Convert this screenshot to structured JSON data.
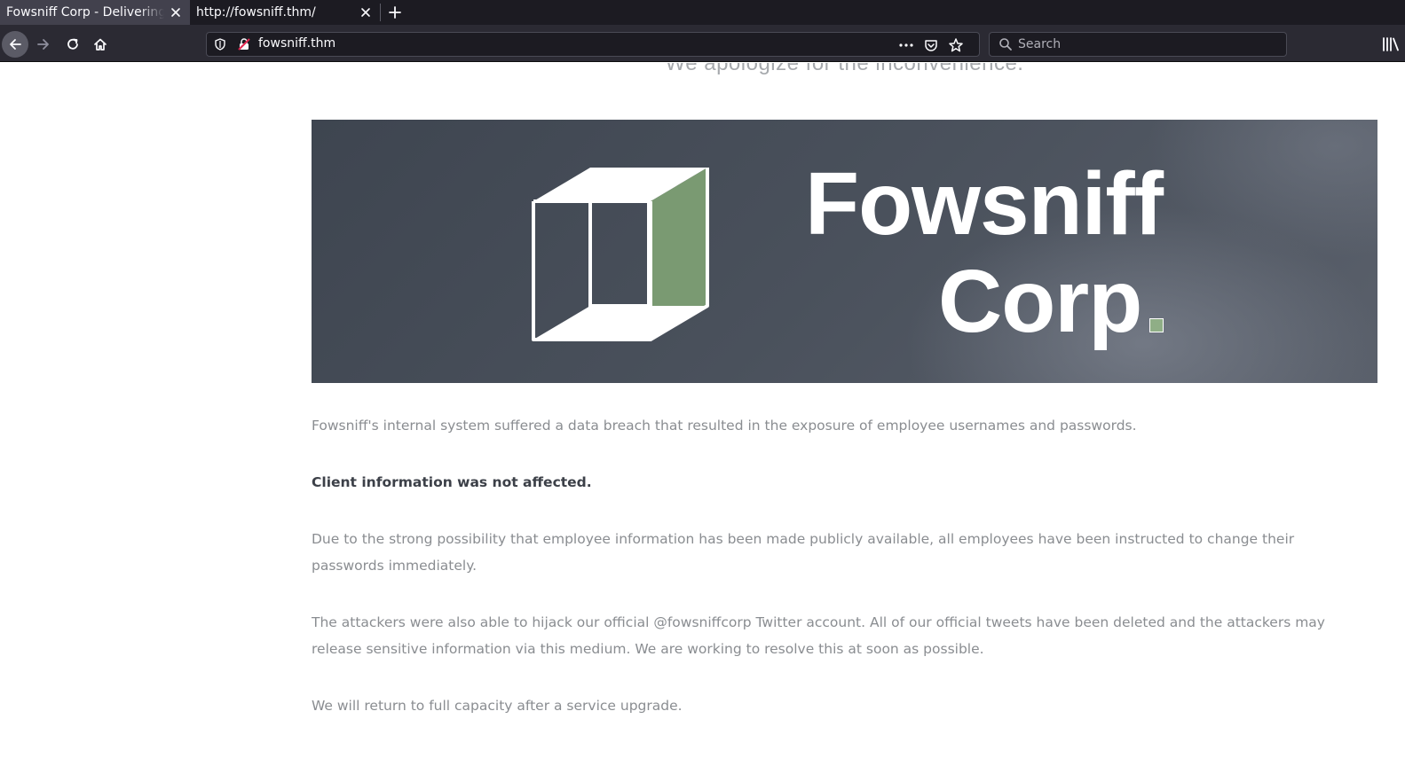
{
  "browser": {
    "tabs": [
      {
        "title": "Fowsniff Corp - Delivering Solutions",
        "active": true
      },
      {
        "title": "http://fowsniff.thm/",
        "active": false
      }
    ],
    "url": "fowsniff.thm",
    "search_placeholder": "Search"
  },
  "page": {
    "partial_heading": "We apologize for the inconvenience.",
    "banner": {
      "brand_line1": "Fowsniff",
      "brand_line2": "Corp",
      "accent_color": "#8fae86"
    },
    "paragraphs": [
      "Fowsniff's internal system suffered a data breach that resulted in the exposure of employee usernames and passwords.",
      "Client information was not affected.",
      "Due to the strong possibility that employee information has been made publicly available, all employees have been instructed to change their passwords immediately.",
      "The attackers were also able to hijack our official @fowsniffcorp Twitter account. All of our official tweets have been deleted and the attackers may release sensitive information via this medium. We are working to resolve this at soon as possible.",
      "We will return to full capacity after a service upgrade."
    ]
  },
  "icons": {
    "back": "arrow-left-icon",
    "forward": "arrow-right-icon",
    "reload": "reload-icon",
    "home": "home-icon",
    "tracking": "shield-icon",
    "insecure": "insecure-lock-icon",
    "page_actions": "more-icon",
    "pocket": "pocket-icon",
    "bookmark": "star-icon",
    "search": "search-icon",
    "library": "library-icon"
  }
}
